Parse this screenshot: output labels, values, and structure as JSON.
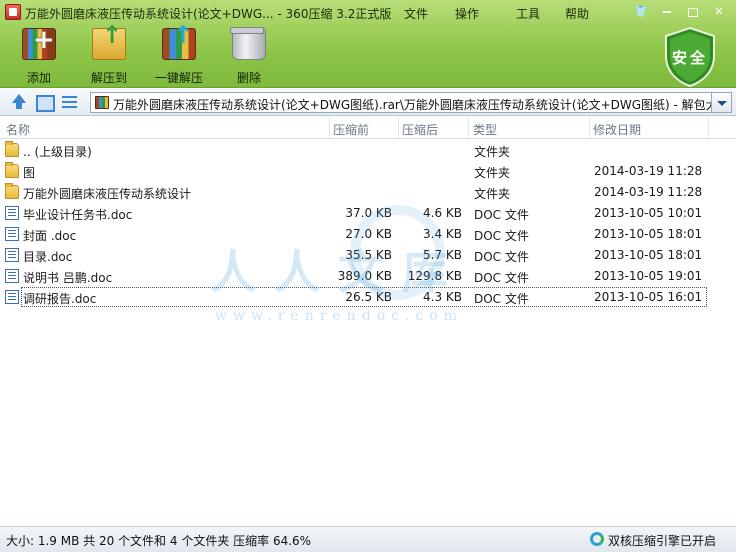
{
  "window": {
    "title": "万能外圆磨床液压传动系统设计(论文+DWG... - 360压缩 3.2正式版",
    "menu": [
      "文件",
      "操作",
      "工具",
      "帮助"
    ]
  },
  "toolbar": {
    "add_label": "添加",
    "extract_label": "解压到",
    "one_click_label": "一键解压",
    "delete_label": "删除",
    "shield_label": "安全"
  },
  "address": {
    "path": "万能外圆磨床液压传动系统设计(论文+DWG图纸).rar\\万能外圆磨床液压传动系统设计(论文+DWG图纸) - 解包大小为"
  },
  "columns": [
    "名称",
    "压缩前",
    "压缩后",
    "类型",
    "修改日期"
  ],
  "files": [
    {
      "name": ".. (上级目录)",
      "size": "",
      "packed": "",
      "type": "文件夹",
      "date": "",
      "icon": "folder-icon"
    },
    {
      "name": "图",
      "size": "",
      "packed": "",
      "type": "文件夹",
      "date": "2014-03-19 11:28",
      "icon": "folder-icon"
    },
    {
      "name": "万能外圆磨床液压传动系统设计",
      "size": "",
      "packed": "",
      "type": "文件夹",
      "date": "2014-03-19 11:28",
      "icon": "folder-icon"
    },
    {
      "name": "毕业设计任务书.doc",
      "size": "37.0 KB",
      "packed": "4.6 KB",
      "type": "DOC 文件",
      "date": "2013-10-05 10:01",
      "icon": "doc-icon"
    },
    {
      "name": "封面 .doc",
      "size": "27.0 KB",
      "packed": "3.4 KB",
      "type": "DOC 文件",
      "date": "2013-10-05 18:01",
      "icon": "doc-icon"
    },
    {
      "name": "目录.doc",
      "size": "35.5 KB",
      "packed": "5.7 KB",
      "type": "DOC 文件",
      "date": "2013-10-05 18:01",
      "icon": "doc-icon"
    },
    {
      "name": "说明书  吕鹏.doc",
      "size": "389.0 KB",
      "packed": "129.8 KB",
      "type": "DOC 文件",
      "date": "2013-10-05 19:01",
      "icon": "doc-icon"
    },
    {
      "name": "调研报告.doc",
      "size": "26.5 KB",
      "packed": "4.3 KB",
      "type": "DOC 文件",
      "date": "2013-10-05 16:01",
      "icon": "doc-icon"
    }
  ],
  "watermark": {
    "text": "人人文库",
    "url": "www.renrendoc.com"
  },
  "status": {
    "summary": "大小: 1.9 MB 共 20 个文件和 4 个文件夹 压缩率 64.6%",
    "engine": "双核压缩引擎已开启"
  },
  "colors": {
    "top_bar": "#8ec548",
    "shield": "#3e9a2c",
    "accent": "#3a86d4"
  }
}
